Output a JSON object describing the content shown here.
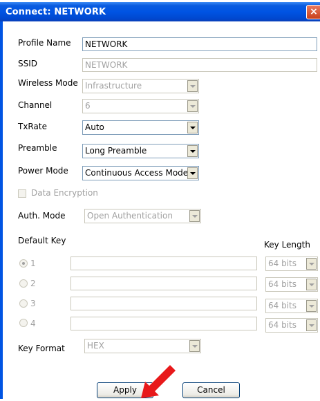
{
  "window": {
    "title": "Connect: NETWORK",
    "close_glyph": "×"
  },
  "form": {
    "profile_name": {
      "label": "Profile Name",
      "value": "NETWORK"
    },
    "ssid": {
      "label": "SSID",
      "value": "NETWORK"
    },
    "wireless_mode": {
      "label": "Wireless Mode",
      "value": "Infrastructure"
    },
    "channel": {
      "label": "Channel",
      "value": "6"
    },
    "txrate": {
      "label": "TxRate",
      "value": "Auto"
    },
    "preamble": {
      "label": "Preamble",
      "value": "Long Preamble"
    },
    "power_mode": {
      "label": "Power Mode",
      "value": "Continuous Access Mode"
    },
    "data_encryption": {
      "label": "Data Encryption",
      "checked": false
    },
    "auth_mode": {
      "label": "Auth. Mode",
      "value": "Open Authentication"
    },
    "default_key_label": "Default Key",
    "key_length_label": "Key Length",
    "keys": [
      {
        "num": "1",
        "value": "",
        "length": "64 bits",
        "selected": true
      },
      {
        "num": "2",
        "value": "",
        "length": "64 bits",
        "selected": false
      },
      {
        "num": "3",
        "value": "",
        "length": "64 bits",
        "selected": false
      },
      {
        "num": "4",
        "value": "",
        "length": "64 bits",
        "selected": false
      }
    ],
    "key_format": {
      "label": "Key Format",
      "value": "HEX"
    }
  },
  "buttons": {
    "apply": "Apply",
    "cancel": "Cancel"
  },
  "annotation": {
    "arrow_color": "#e8191b"
  }
}
